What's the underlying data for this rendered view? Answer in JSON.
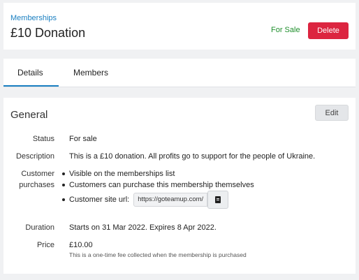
{
  "header": {
    "breadcrumb": "Memberships",
    "title": "£10 Donation",
    "status": "For Sale",
    "delete_label": "Delete"
  },
  "tabs": [
    {
      "label": "Details",
      "active": true
    },
    {
      "label": "Members",
      "active": false
    }
  ],
  "general": {
    "title": "General",
    "edit_label": "Edit",
    "status": {
      "label": "Status",
      "value": "For sale"
    },
    "description": {
      "label": "Description",
      "value": "This is a £10 donation. All profits go to support for the people of Ukraine."
    },
    "customer_purchases": {
      "label_line1": "Customer",
      "label_line2": "purchases",
      "items": [
        "Visible on the memberships list",
        "Customers can purchase this membership themselves"
      ],
      "site_url_label": "Customer site url:",
      "site_url": "https://goteamup.com/",
      "copy_icon": "clipboard-icon"
    },
    "duration": {
      "label": "Duration",
      "value": "Starts on 31 Mar 2022. Expires 8 Apr 2022."
    },
    "price": {
      "label": "Price",
      "value": "£10.00",
      "note": "This is a one-time fee collected when the membership is purchased"
    }
  },
  "colors": {
    "accent": "#1a7fc1",
    "status_green": "#1f8f2c",
    "delete_red": "#dc2540",
    "background": "#f0f1f3"
  }
}
